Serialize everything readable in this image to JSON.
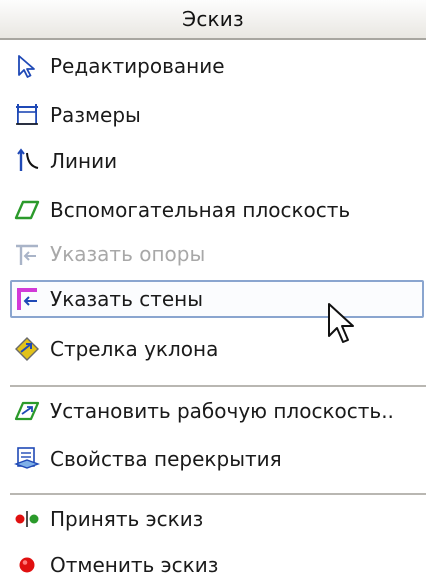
{
  "menu": {
    "title": "Эскиз",
    "items": [
      {
        "label": "Редактирование",
        "icon": "edit-arrow-icon",
        "enabled": true
      },
      {
        "label": "Размеры",
        "icon": "dimensions-icon",
        "enabled": true
      },
      {
        "label": "Линии",
        "icon": "lines-icon",
        "enabled": true
      },
      {
        "label": "Вспомогательная плоскость",
        "icon": "reference-plane-icon",
        "enabled": true
      },
      {
        "label": "Указать опоры",
        "icon": "pick-supports-icon",
        "enabled": false
      },
      {
        "label": "Указать стены",
        "icon": "pick-walls-icon",
        "enabled": true,
        "hovered": true
      },
      {
        "label": "Стрелка уклона",
        "icon": "slope-arrow-icon",
        "enabled": true
      },
      {
        "label": "Установить рабочую плоскость..",
        "icon": "set-work-plane-icon",
        "enabled": true
      },
      {
        "label": "Свойства перекрытия",
        "icon": "floor-properties-icon",
        "enabled": true
      },
      {
        "label": "Принять эскиз",
        "icon": "finish-sketch-icon",
        "enabled": true
      },
      {
        "label": "Отменить эскиз",
        "icon": "cancel-sketch-icon",
        "enabled": true
      }
    ]
  },
  "colors": {
    "hover_border": "#8aa5cf",
    "icon_blue": "#1f49b6",
    "icon_green": "#2b9a2b",
    "icon_red": "#e01010",
    "disabled_text": "#a8a8a8"
  }
}
